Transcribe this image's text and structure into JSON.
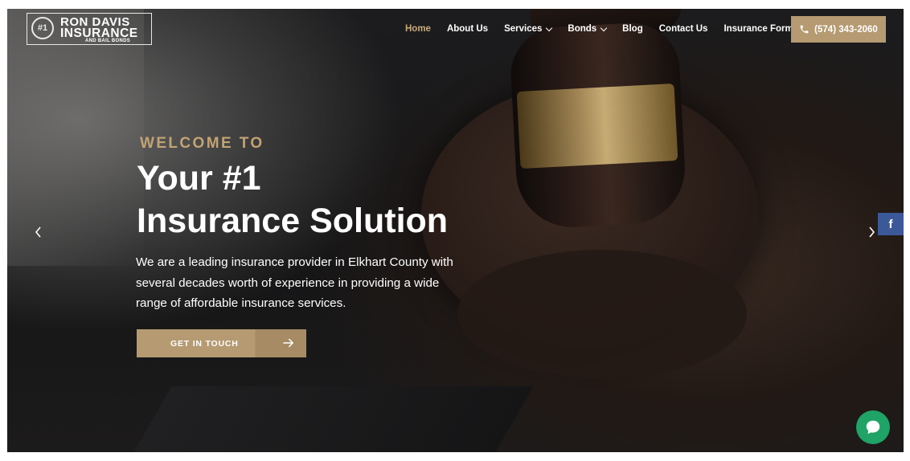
{
  "logo": {
    "emblem": "#1",
    "line1": "RON DAVIS",
    "line2": "INSURANCE",
    "line3": "AND BAIL BONDS"
  },
  "nav": {
    "items": [
      {
        "label": "Home",
        "active": true
      },
      {
        "label": "About Us"
      },
      {
        "label": "Services",
        "dropdown": true
      },
      {
        "label": "Bonds",
        "dropdown": true
      },
      {
        "label": "Blog"
      },
      {
        "label": "Contact Us"
      },
      {
        "label": "Insurance Form"
      }
    ],
    "phone": "(574) 343-2060"
  },
  "hero": {
    "eyebrow": "WELCOME TO",
    "headline_line1": "Your #1",
    "headline_line2": "Insurance Solution",
    "description": "We are a leading insurance provider in Elkhart County with several decades worth of experience in providing a wide range of affordable insurance services.",
    "cta": "GET IN TOUCH"
  },
  "social": {
    "facebook": "f"
  },
  "colors": {
    "accent": "#b59a72",
    "eyebrow": "#c2a374",
    "active_nav": "#c7aa7c",
    "facebook": "#3b5998",
    "chat": "#1fa366"
  },
  "icons": [
    "phone-icon",
    "arrow-right-icon",
    "chevron-left-icon",
    "chevron-right-icon",
    "facebook-icon",
    "chat-icon",
    "chevron-down-icon"
  ]
}
